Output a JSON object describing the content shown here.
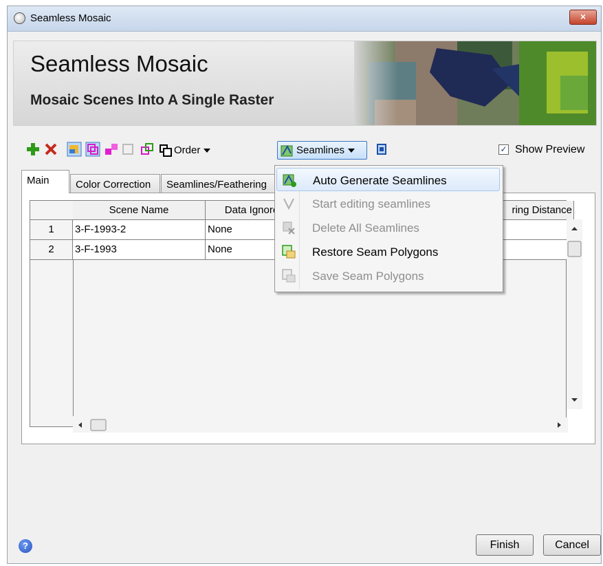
{
  "window": {
    "title": "Seamless Mosaic",
    "close_label": "×"
  },
  "banner": {
    "title": "Seamless Mosaic",
    "subtitle": "Mosaic Scenes Into A Single Raster"
  },
  "toolbar": {
    "order_label": "Order",
    "seamlines_label": "Seamlines",
    "show_preview_label": "Show Preview",
    "show_preview_checked": true
  },
  "tabs": [
    {
      "label": "Main",
      "active": true
    },
    {
      "label": "Color Correction",
      "active": false
    },
    {
      "label": "Seamlines/Feathering",
      "active": false
    }
  ],
  "table": {
    "columns": [
      "Scene Name",
      "Data Ignore",
      "Feathering Distance"
    ],
    "visible_column_text": [
      "Scene Name",
      "Data Ignore",
      "ring Distance"
    ],
    "rows": [
      {
        "num": "1",
        "scene": "3-F-1993-2",
        "ignore": "None"
      },
      {
        "num": "2",
        "scene": "3-F-1993",
        "ignore": "None"
      }
    ]
  },
  "seamlines_menu": {
    "items": [
      {
        "label": "Auto Generate Seamlines",
        "enabled": true,
        "highlighted": true,
        "icon": "auto-generate-seamlines-icon"
      },
      {
        "label": "Start editing seamlines",
        "enabled": false,
        "icon": "edit-seamlines-icon"
      },
      {
        "label": "Delete All Seamlines",
        "enabled": false,
        "icon": "delete-seamlines-icon"
      },
      {
        "label": "Restore Seam Polygons",
        "enabled": true,
        "icon": "restore-polygons-icon"
      },
      {
        "label": "Save Seam Polygons",
        "enabled": false,
        "icon": "save-polygons-icon"
      }
    ]
  },
  "footer": {
    "help_label": "?",
    "finish_label": "Finish",
    "cancel_label": "Cancel"
  },
  "colors": {
    "accent": "#3b77c6",
    "menu_highlight": "#dceafb",
    "disabled_text": "#8e8e8e"
  }
}
